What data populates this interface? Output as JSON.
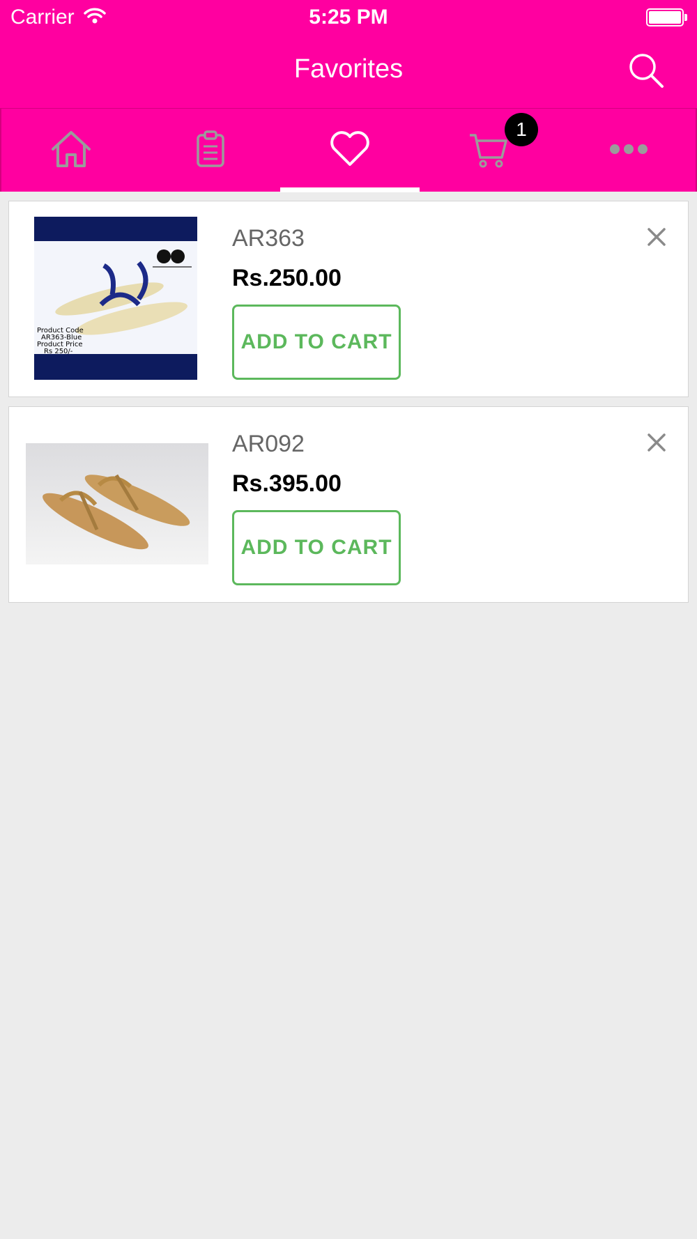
{
  "status_bar": {
    "carrier": "Carrier",
    "time": "5:25 PM"
  },
  "header": {
    "title": "Favorites"
  },
  "tabs": [
    {
      "icon": "home-icon"
    },
    {
      "icon": "clipboard-icon"
    },
    {
      "icon": "heart-icon",
      "active": true
    },
    {
      "icon": "cart-icon",
      "badge": "1"
    },
    {
      "icon": "more-icon"
    }
  ],
  "favorites": [
    {
      "sku": "AR363",
      "price": "Rs.250.00",
      "button": "ADD TO CART",
      "image_text": [
        "Product Code",
        "AR363-Blue",
        "Product Price",
        "Rs 250/-"
      ]
    },
    {
      "sku": "AR092",
      "price": "Rs.395.00",
      "button": "ADD TO CART"
    }
  ],
  "colors": {
    "brand": "#ff00a0",
    "accent_green": "#5cb85c",
    "icon_gray": "#9b9b9b",
    "background": "#ececec"
  }
}
